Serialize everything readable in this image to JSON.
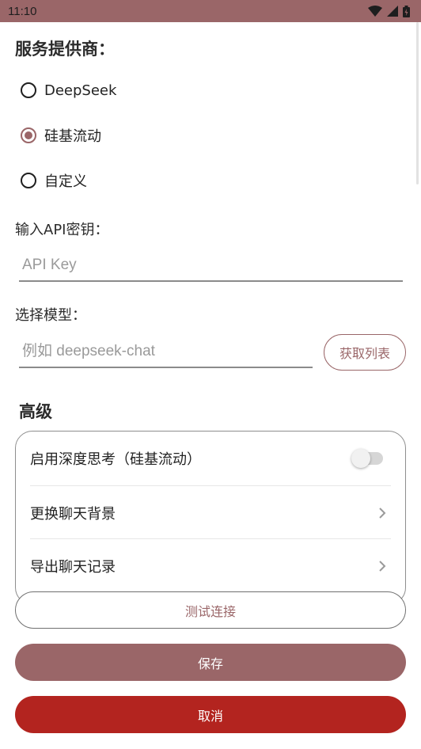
{
  "status_bar": {
    "time": "11:10"
  },
  "provider": {
    "title": "服务提供商：",
    "options": [
      {
        "label": "DeepSeek",
        "checked": false
      },
      {
        "label": "硅基流动",
        "checked": true
      },
      {
        "label": "自定义",
        "checked": false
      }
    ]
  },
  "api_key": {
    "label": "输入API密钥：",
    "placeholder": "API Key",
    "value": ""
  },
  "model": {
    "label": "选择模型：",
    "placeholder": "例如 deepseek-chat",
    "value": "",
    "fetch_label": "获取列表"
  },
  "advanced": {
    "title": "高级",
    "items": [
      {
        "label": "启用深度思考（硅基流动）",
        "control": "toggle",
        "enabled": false
      },
      {
        "label": "更换聊天背景",
        "control": "chevron"
      },
      {
        "label": "导出聊天记录",
        "control": "chevron"
      }
    ]
  },
  "buttons": {
    "test": "测试连接",
    "save": "保存",
    "cancel": "取消"
  },
  "colors": {
    "accent": "#9a6668",
    "danger": "#b3241f"
  }
}
